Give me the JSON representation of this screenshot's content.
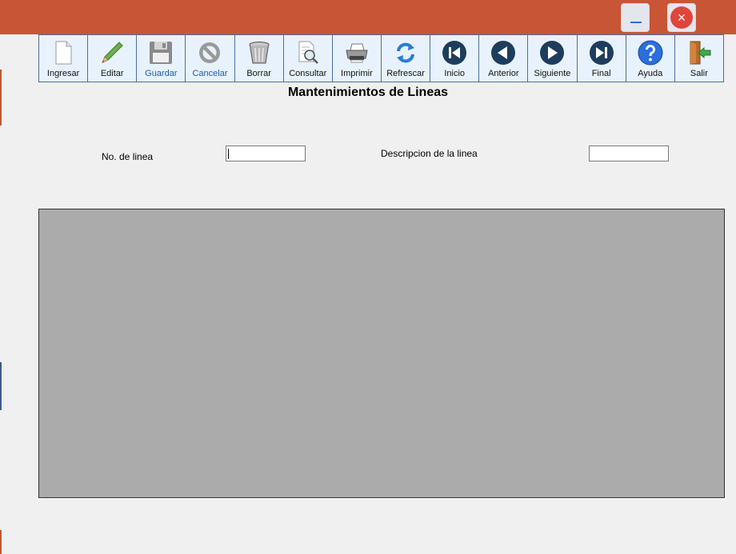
{
  "toolbar": {
    "buttons": [
      {
        "label": "Ingresar",
        "icon": "new-document-icon"
      },
      {
        "label": "Editar",
        "icon": "pencil-icon"
      },
      {
        "label": "Guardar",
        "icon": "floppy-disk-icon"
      },
      {
        "label": "Cancelar",
        "icon": "cancel-icon"
      },
      {
        "label": "Borrar",
        "icon": "trash-can-icon"
      },
      {
        "label": "Consultar",
        "icon": "search-document-icon"
      },
      {
        "label": "Imprimir",
        "icon": "printer-icon"
      },
      {
        "label": "Refrescar",
        "icon": "refresh-icon"
      },
      {
        "label": "Inicio",
        "icon": "first-record-icon"
      },
      {
        "label": "Anterior",
        "icon": "previous-record-icon"
      },
      {
        "label": "Siguiente",
        "icon": "next-record-icon"
      },
      {
        "label": "Final",
        "icon": "last-record-icon"
      },
      {
        "label": "Ayuda",
        "icon": "help-icon"
      },
      {
        "label": "Salir",
        "icon": "exit-door-icon"
      }
    ]
  },
  "form": {
    "title": "Mantenimientos de  Lineas",
    "line_number_label": "No. de linea",
    "line_number_value": "",
    "description_label": "Descripcion de la linea",
    "description_value": ""
  },
  "window": {
    "close_glyph": "×"
  },
  "colors": {
    "titlebar": "#c85535",
    "toolbar_bg": "#e8f2fc",
    "toolbar_border": "#4a6f9e",
    "grid_bg": "#ababab"
  }
}
